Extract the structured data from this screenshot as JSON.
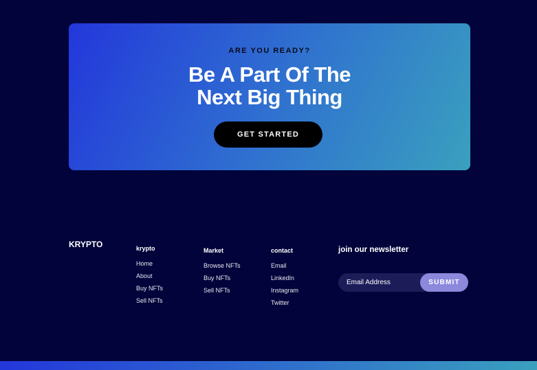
{
  "cta": {
    "eyebrow": "ARE YOU READY?",
    "headline_line1": "Be A Part Of The",
    "headline_line2": "Next Big Thing",
    "button": "GET STARTED"
  },
  "footer": {
    "brand": "KRYPTO",
    "columns": [
      {
        "title": "krypto",
        "links": [
          "Home",
          "About",
          "Buy NFTs",
          "Sell NFTs"
        ]
      },
      {
        "title": "Market",
        "links": [
          "Browse NFTs",
          "Buy NFTs",
          "Sell NFTs"
        ]
      },
      {
        "title": "contact",
        "links": [
          "Email",
          "LinkedIn",
          "Instagram",
          "Twitter"
        ]
      }
    ],
    "newsletter": {
      "title": "join our newsletter",
      "placeholder": "Email Address",
      "submit": "SUBMIT"
    }
  }
}
